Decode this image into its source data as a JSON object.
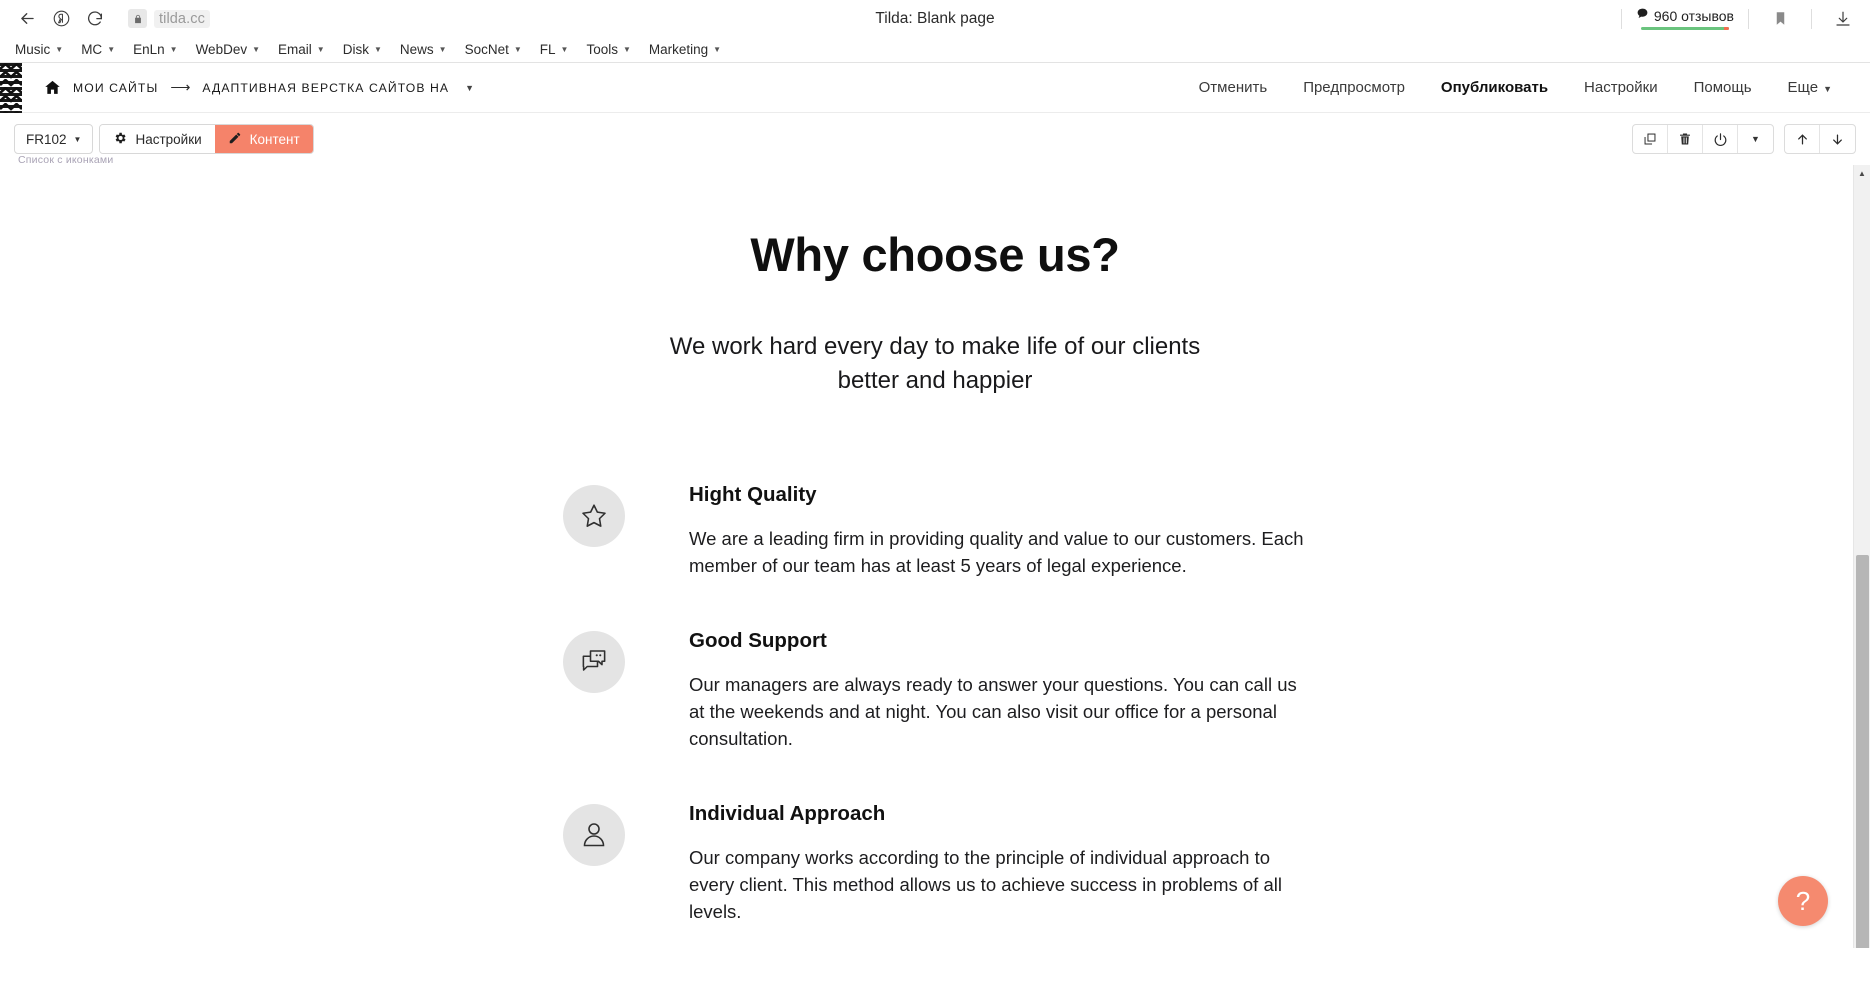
{
  "browser": {
    "tab_title": "Tilda: Blank page",
    "url": "tilda.cc",
    "back_icon": "back-arrow-icon",
    "profile_icon": "yandex-profile-icon",
    "reload_icon": "reload-icon",
    "lock_icon": "lock-icon",
    "reviews_count": "960 отзывов",
    "bookmark_icon": "bookmark-icon",
    "download_icon": "download-icon",
    "bookmarks": [
      {
        "label": "Music"
      },
      {
        "label": "MC"
      },
      {
        "label": "EnLn"
      },
      {
        "label": "WebDev"
      },
      {
        "label": "Email"
      },
      {
        "label": "Disk"
      },
      {
        "label": "News"
      },
      {
        "label": "SocNet"
      },
      {
        "label": "FL"
      },
      {
        "label": "Tools"
      },
      {
        "label": "Marketing"
      }
    ]
  },
  "tilda_header": {
    "logo": "zigzag-pattern-logo",
    "home_icon": "home-icon",
    "breadcrumb_root": "МОИ САЙТЫ",
    "breadcrumb_arrow": "⟶",
    "breadcrumb_current": "АДАПТИВНАЯ ВЕРСТКА САЙТОВ НА",
    "nav": [
      {
        "label": "Отменить",
        "active": false
      },
      {
        "label": "Предпросмотр",
        "active": false
      },
      {
        "label": "Опубликовать",
        "active": true
      },
      {
        "label": "Настройки",
        "active": false
      },
      {
        "label": "Помощь",
        "active": false
      },
      {
        "label": "Еще",
        "active": false,
        "has_caret": true
      }
    ]
  },
  "block_toolbar": {
    "block_id": "FR102",
    "settings_label": "Настройки",
    "settings_icon": "gear-icon",
    "content_label": "Контент",
    "content_icon": "pencil-icon",
    "block_label": "Список с иконками",
    "actions": [
      {
        "icon": "duplicate-icon",
        "name": "duplicate-block-button"
      },
      {
        "icon": "trash-icon",
        "name": "delete-block-button"
      },
      {
        "icon": "power-icon",
        "name": "toggle-block-button"
      },
      {
        "icon": "chevron-down-icon",
        "name": "more-actions-button"
      }
    ],
    "move_actions": [
      {
        "icon": "arrow-up-icon",
        "name": "move-block-up-button"
      },
      {
        "icon": "arrow-down-icon",
        "name": "move-block-down-button"
      }
    ]
  },
  "page": {
    "title": "Why choose us?",
    "subtitle": "We work hard every day to make life of our clients\nbetter and happier",
    "features": [
      {
        "icon": "star-icon",
        "title": "Hight Quality",
        "text": "We are a leading firm in providing quality and value to our customers. Each member of our team has at least 5 years of legal experience."
      },
      {
        "icon": "chat-bubbles-icon",
        "title": "Good Support",
        "text": "Our managers are always ready to answer your questions. You can call us at the weekends and at night. You can also visit our office for a personal consultation."
      },
      {
        "icon": "user-icon",
        "title": "Individual Approach",
        "text": "Our company works according to the principle of individual approach to every client. This method allows us to achieve success in problems of all levels."
      }
    ],
    "help_button_label": "?"
  },
  "colors": {
    "accent_coral": "#f5836a",
    "help_coral": "#f58a6f",
    "rating_green": "#6ac47e",
    "icon_bg": "#e4e4e4"
  }
}
